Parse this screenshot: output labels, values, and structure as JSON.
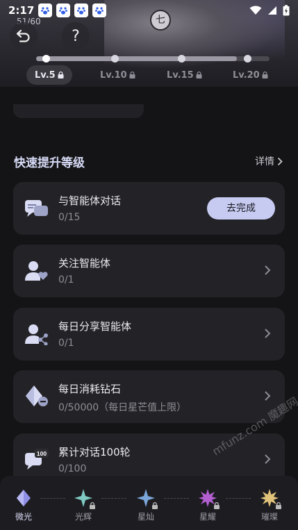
{
  "status": {
    "time": "2:17"
  },
  "header": {
    "counter": "51/60"
  },
  "level_progress": {
    "fraction": 0.86
  },
  "levels": [
    {
      "label": "Lv.5",
      "active": true
    },
    {
      "label": "Lv.10",
      "active": false
    },
    {
      "label": "Lv.15",
      "active": false
    },
    {
      "label": "Lv.20",
      "active": false
    }
  ],
  "section": {
    "title": "快速提升等级",
    "detail_label": "详情"
  },
  "tasks": [
    {
      "title": "与智能体对话",
      "progress": "0/15",
      "action_label": "去完成",
      "icon": "chat-bubbles-icon"
    },
    {
      "title": "关注智能体",
      "progress": "0/1",
      "icon": "follow-user-icon"
    },
    {
      "title": "每日分享智能体",
      "progress": "0/1",
      "icon": "share-user-icon"
    },
    {
      "title": "每日消耗钻石",
      "progress": "0/50000（每日星芒值上限）",
      "icon": "diamond-minus-icon"
    },
    {
      "title": "累计对话100轮",
      "progress": "0/100",
      "icon": "chat-100-icon"
    }
  ],
  "tabs": [
    {
      "label": "微光",
      "active": true,
      "color": "#8f8fe6"
    },
    {
      "label": "光辉",
      "active": false,
      "color": "#7fc9c2"
    },
    {
      "label": "星灿",
      "active": false,
      "color": "#7aa6d9"
    },
    {
      "label": "星耀",
      "active": false,
      "color": "#b35fd1"
    },
    {
      "label": "璀璨",
      "active": false,
      "color": "#e0c27a"
    }
  ],
  "watermark": "mfunz.com 魔趣网"
}
